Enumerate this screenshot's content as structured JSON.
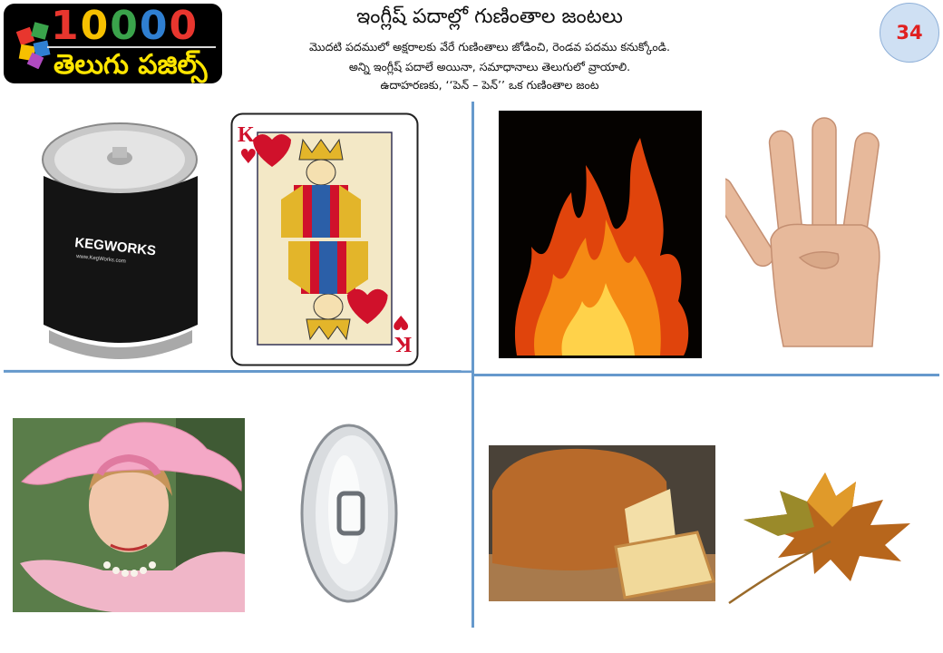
{
  "logo": {
    "number": "10000",
    "subtitle": "తెలుగు పజిల్స్"
  },
  "header": {
    "title": "ఇంగ్లీష్ పదాల్లో గుణింతాల జంటలు",
    "instructions": [
      "మొదటి పదములో అక్షరాలకు వేరే గుణింతాలు జోడించి, రెండవ పదము కనుక్కోండి.",
      "అన్ని ఇంగ్లీష్ పదాలే అయినా, సమాధానాలు తెలుగులో వ్రాయాలి.",
      "ఉదాహరణకు,  ‘‘పెన్ – పెన్’’  ఒక గుణింతాల జంట"
    ],
    "page_number": "34"
  },
  "pictures": {
    "keg_brand": "KEGWORKS",
    "keg_url": "www.KegWorks.com",
    "card_rank": "K",
    "card_suit": "♥"
  },
  "colors": {
    "divider": "#6699cc",
    "page_circle_fill": "#cfe0f3",
    "page_number_color": "#e02020",
    "logo_yellow": "#ffe600"
  }
}
